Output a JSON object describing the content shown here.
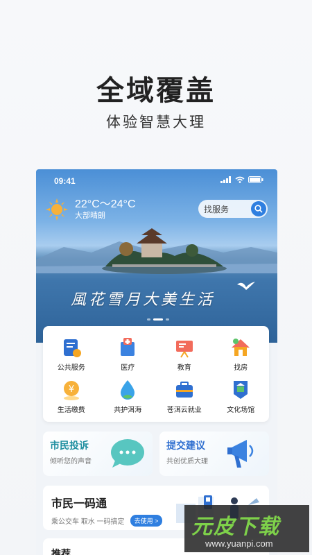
{
  "header": {
    "title": "全域覆盖",
    "subtitle": "体验智慧大理"
  },
  "status_bar": {
    "time": "09:41"
  },
  "weather": {
    "temperature": "22°C～24°C",
    "description": "大部晴朗"
  },
  "search": {
    "placeholder": "找服务"
  },
  "banner": {
    "calligraphy": "風花雪月大美生活"
  },
  "services": [
    {
      "label": "公共服务",
      "icon": "public-service-icon"
    },
    {
      "label": "医疗",
      "icon": "medical-icon"
    },
    {
      "label": "教育",
      "icon": "education-icon"
    },
    {
      "label": "找房",
      "icon": "house-icon"
    },
    {
      "label": "生活缴费",
      "icon": "payment-icon"
    },
    {
      "label": "共护洱海",
      "icon": "water-drop-icon"
    },
    {
      "label": "苍洱云就业",
      "icon": "briefcase-icon"
    },
    {
      "label": "文化场馆",
      "icon": "museum-icon"
    }
  ],
  "complaint": {
    "title": "市民投诉",
    "subtitle": "倾听您的声音"
  },
  "suggestion": {
    "title": "提交建议",
    "subtitle": "共创优质大理"
  },
  "citizen_code": {
    "title": "市民一码通",
    "subtitle": "乘公交车 取水 一码搞定",
    "button": "去使用 >"
  },
  "recommend": {
    "title": "推荐"
  },
  "watermark": {
    "text": "元皮下载",
    "url": "www.yuanpi.com"
  },
  "colors": {
    "accent": "#2f7fe0",
    "complaint_title": "#1f8fa0",
    "suggestion_title": "#2f6fd0"
  }
}
